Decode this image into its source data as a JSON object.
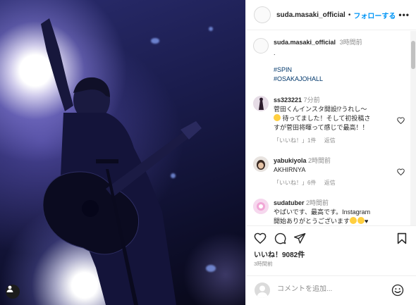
{
  "post": {
    "username": "suda.masaki_official",
    "follow_label": "フォローする",
    "separator": "•",
    "more_label": "•••"
  },
  "caption": {
    "username": "suda.masaki_official",
    "time": "3時間前",
    "text": ".",
    "hashtags": [
      "#SPIN",
      "#OSAKAJOHALL"
    ]
  },
  "comments": [
    {
      "username": "ss323221",
      "time": "7分前",
      "text_line1": "菅田くんインスタ開設⁉うれし～",
      "text_line2": "待ってました！そして初投稿さ",
      "text_line3": "すが菅田将暉って感じで最高！！",
      "likes": "「いいね！」1件",
      "reply": "返信"
    },
    {
      "username": "yabukiyola",
      "time": "2時間前",
      "text_line1": "AKHIRNYA",
      "likes": "「いいね！」6件",
      "reply": "返信"
    },
    {
      "username": "sudatuber",
      "time": "2時間前",
      "text_line1": "やばいです、最高です。Instagram",
      "text_line2": "開始ありがとうございます"
    }
  ],
  "stats": {
    "likes": "いいね！9082件",
    "posted": "3時間前"
  },
  "comment_input": {
    "placeholder": "コメントを追加..."
  },
  "icons": {
    "like": "heart-icon",
    "comment": "comment-icon",
    "share": "share-icon",
    "save": "bookmark-icon",
    "emoji": "emoji-icon",
    "user_tag": "user-icon"
  },
  "colors": {
    "accent": "#0095f6",
    "text": "#262626",
    "muted": "#8e8e8e",
    "hashtag": "#00376b"
  }
}
